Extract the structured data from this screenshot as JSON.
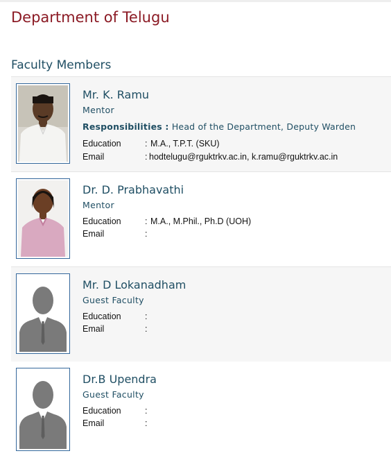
{
  "page": {
    "department_title": "Department of Telugu",
    "section_title": "Faculty Members"
  },
  "labels": {
    "responsibilities": "Responsibilities :",
    "education": "Education",
    "email": "Email",
    "colon": ":"
  },
  "faculty": [
    {
      "name": "Mr. K. Ramu",
      "role": "Mentor",
      "responsibilities": "Head of the Department, Deputy Warden",
      "education": "M.A., T.P.T. (SKU)",
      "email": "hodtelugu@rguktrkv.ac.in, k.ramu@rguktrkv.ac.in",
      "photo": "male-photo"
    },
    {
      "name": "Dr. D. Prabhavathi",
      "role": "Mentor",
      "education": "M.A., M.Phil., Ph.D (UOH)",
      "email": "",
      "photo": "female-photo"
    },
    {
      "name": "Mr. D Lokanadham",
      "role": "Guest Faculty",
      "education": "",
      "email": "",
      "photo": "person-placeholder-icon"
    },
    {
      "name": "Dr.B Upendra",
      "role": "Guest Faculty",
      "education": "",
      "email": "",
      "photo": "person-placeholder-icon"
    }
  ],
  "colors": {
    "department_title": "#8b1a24",
    "accent": "#1f4e63",
    "photo_border": "#33679b",
    "card_shade": "#f6f6f6",
    "placeholder_gray": "#7a7a7a"
  }
}
